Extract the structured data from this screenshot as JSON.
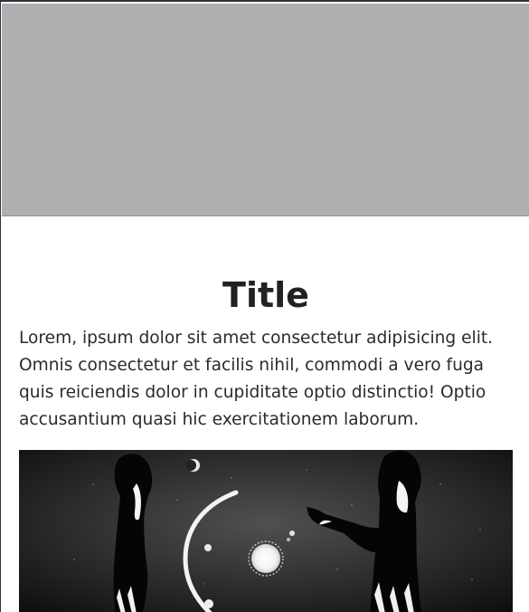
{
  "article": {
    "title": "Title",
    "body": "Lorem, ipsum dolor sit amet consectetur adipisicing elit. Omnis consectetur et facilis nihil, commodi a vero fuga quis reiciendis dolor in cupiditate optio distinctio! Optio accusantium quasi hic exercitationem laborum."
  },
  "colors": {
    "banner": "#afafaf",
    "background": "#ffffff",
    "text": "#212529"
  }
}
